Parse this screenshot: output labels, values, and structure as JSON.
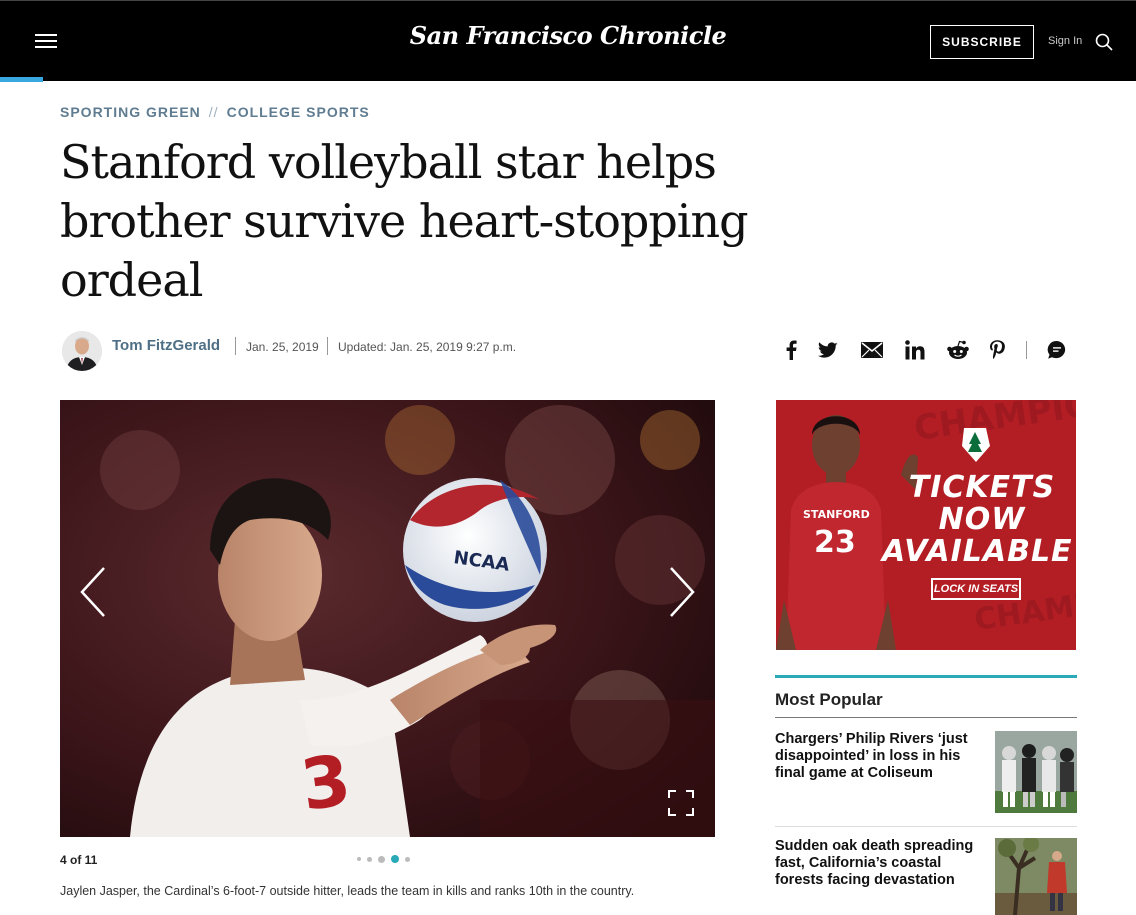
{
  "header": {
    "logo": "San Francisco Chronicle",
    "subscribe_label": "SUBSCRIBE",
    "signin_label": "Sign In"
  },
  "breadcrumb": {
    "section": "SPORTING GREEN",
    "separator": "//",
    "subsection": "COLLEGE SPORTS"
  },
  "article": {
    "headline": "Stanford volleyball star helps brother survive heart-stopping ordeal",
    "author": "Tom FitzGerald",
    "date": "Jan. 25, 2019",
    "updated": "Updated: Jan. 25, 2019 9:27 p.m."
  },
  "share_icons": [
    "facebook-icon",
    "twitter-icon",
    "email-icon",
    "linkedin-icon",
    "reddit-icon",
    "pinterest-icon",
    "comments-icon"
  ],
  "gallery": {
    "counter": "4 of 11",
    "caption": "Jaylen Jasper, the Cardinal’s 6-foot-7 outside hitter, leads the team in kills and ranks 10th in the country.",
    "jersey_number": "3",
    "ball_text": "NCAA"
  },
  "ad": {
    "school_label": "STANFORD",
    "number": "23",
    "headline_line1": "TICKETS",
    "headline_line2": "NOW",
    "headline_line3": "AVAILABLE",
    "button_label": "LOCK IN SEATS",
    "brand_color": "#b31d24"
  },
  "most_popular": {
    "title": "Most Popular",
    "items": [
      {
        "title": "Chargers’ Philip Rivers ‘just disappointed’ in loss in his final game at Coliseum"
      },
      {
        "title": "Sudden oak death spreading fast, California’s coastal forests facing devastation"
      }
    ]
  },
  "colors": {
    "accent_blue": "#3aa8e0",
    "section_label": "#5f7c91",
    "popular_rule": "#2aa9b8",
    "active_dot": "#2aa9b8"
  }
}
